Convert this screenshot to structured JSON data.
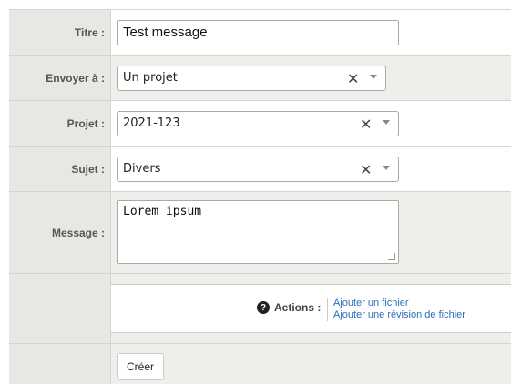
{
  "form": {
    "title_label": "Titre :",
    "title_value": "Test message",
    "send_to_label": "Envoyer à :",
    "send_to_value": "Un projet",
    "project_label": "Projet :",
    "project_value": "2021-123",
    "subject_label": "Sujet :",
    "subject_value": "Divers",
    "message_label": "Message :",
    "message_value": "Lorem ipsum",
    "clear_glyph": "✕",
    "actions_label": "Actions :",
    "help_glyph": "?",
    "actions_links": [
      "Ajouter un fichier",
      "Ajouter une révision de fichier"
    ],
    "submit_label": "Créer"
  },
  "icons": {
    "help": "help-circle-icon",
    "clear": "close-icon",
    "dropdown": "chevron-down-icon"
  },
  "colors": {
    "label_bg": "#e8e7e3",
    "grey_row_bg": "#efeeeb",
    "link": "#2a6ebb"
  }
}
